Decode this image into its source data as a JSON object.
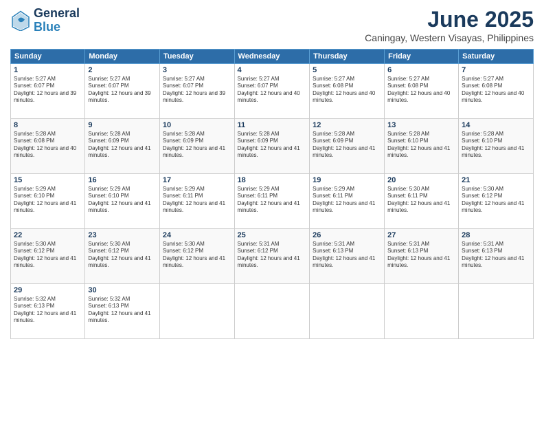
{
  "logo": {
    "line1": "General",
    "line2": "Blue"
  },
  "title": "June 2025",
  "location": "Caningay, Western Visayas, Philippines",
  "headers": [
    "Sunday",
    "Monday",
    "Tuesday",
    "Wednesday",
    "Thursday",
    "Friday",
    "Saturday"
  ],
  "weeks": [
    [
      {
        "day": "1",
        "sunrise": "5:27 AM",
        "sunset": "6:07 PM",
        "daylight": "12 hours and 39 minutes."
      },
      {
        "day": "2",
        "sunrise": "5:27 AM",
        "sunset": "6:07 PM",
        "daylight": "12 hours and 39 minutes."
      },
      {
        "day": "3",
        "sunrise": "5:27 AM",
        "sunset": "6:07 PM",
        "daylight": "12 hours and 39 minutes."
      },
      {
        "day": "4",
        "sunrise": "5:27 AM",
        "sunset": "6:07 PM",
        "daylight": "12 hours and 40 minutes."
      },
      {
        "day": "5",
        "sunrise": "5:27 AM",
        "sunset": "6:08 PM",
        "daylight": "12 hours and 40 minutes."
      },
      {
        "day": "6",
        "sunrise": "5:27 AM",
        "sunset": "6:08 PM",
        "daylight": "12 hours and 40 minutes."
      },
      {
        "day": "7",
        "sunrise": "5:27 AM",
        "sunset": "6:08 PM",
        "daylight": "12 hours and 40 minutes."
      }
    ],
    [
      {
        "day": "8",
        "sunrise": "5:28 AM",
        "sunset": "6:08 PM",
        "daylight": "12 hours and 40 minutes."
      },
      {
        "day": "9",
        "sunrise": "5:28 AM",
        "sunset": "6:09 PM",
        "daylight": "12 hours and 41 minutes."
      },
      {
        "day": "10",
        "sunrise": "5:28 AM",
        "sunset": "6:09 PM",
        "daylight": "12 hours and 41 minutes."
      },
      {
        "day": "11",
        "sunrise": "5:28 AM",
        "sunset": "6:09 PM",
        "daylight": "12 hours and 41 minutes."
      },
      {
        "day": "12",
        "sunrise": "5:28 AM",
        "sunset": "6:09 PM",
        "daylight": "12 hours and 41 minutes."
      },
      {
        "day": "13",
        "sunrise": "5:28 AM",
        "sunset": "6:10 PM",
        "daylight": "12 hours and 41 minutes."
      },
      {
        "day": "14",
        "sunrise": "5:28 AM",
        "sunset": "6:10 PM",
        "daylight": "12 hours and 41 minutes."
      }
    ],
    [
      {
        "day": "15",
        "sunrise": "5:29 AM",
        "sunset": "6:10 PM",
        "daylight": "12 hours and 41 minutes."
      },
      {
        "day": "16",
        "sunrise": "5:29 AM",
        "sunset": "6:10 PM",
        "daylight": "12 hours and 41 minutes."
      },
      {
        "day": "17",
        "sunrise": "5:29 AM",
        "sunset": "6:11 PM",
        "daylight": "12 hours and 41 minutes."
      },
      {
        "day": "18",
        "sunrise": "5:29 AM",
        "sunset": "6:11 PM",
        "daylight": "12 hours and 41 minutes."
      },
      {
        "day": "19",
        "sunrise": "5:29 AM",
        "sunset": "6:11 PM",
        "daylight": "12 hours and 41 minutes."
      },
      {
        "day": "20",
        "sunrise": "5:30 AM",
        "sunset": "6:11 PM",
        "daylight": "12 hours and 41 minutes."
      },
      {
        "day": "21",
        "sunrise": "5:30 AM",
        "sunset": "6:12 PM",
        "daylight": "12 hours and 41 minutes."
      }
    ],
    [
      {
        "day": "22",
        "sunrise": "5:30 AM",
        "sunset": "6:12 PM",
        "daylight": "12 hours and 41 minutes."
      },
      {
        "day": "23",
        "sunrise": "5:30 AM",
        "sunset": "6:12 PM",
        "daylight": "12 hours and 41 minutes."
      },
      {
        "day": "24",
        "sunrise": "5:30 AM",
        "sunset": "6:12 PM",
        "daylight": "12 hours and 41 minutes."
      },
      {
        "day": "25",
        "sunrise": "5:31 AM",
        "sunset": "6:12 PM",
        "daylight": "12 hours and 41 minutes."
      },
      {
        "day": "26",
        "sunrise": "5:31 AM",
        "sunset": "6:13 PM",
        "daylight": "12 hours and 41 minutes."
      },
      {
        "day": "27",
        "sunrise": "5:31 AM",
        "sunset": "6:13 PM",
        "daylight": "12 hours and 41 minutes."
      },
      {
        "day": "28",
        "sunrise": "5:31 AM",
        "sunset": "6:13 PM",
        "daylight": "12 hours and 41 minutes."
      }
    ],
    [
      {
        "day": "29",
        "sunrise": "5:32 AM",
        "sunset": "6:13 PM",
        "daylight": "12 hours and 41 minutes."
      },
      {
        "day": "30",
        "sunrise": "5:32 AM",
        "sunset": "6:13 PM",
        "daylight": "12 hours and 41 minutes."
      },
      null,
      null,
      null,
      null,
      null
    ]
  ]
}
